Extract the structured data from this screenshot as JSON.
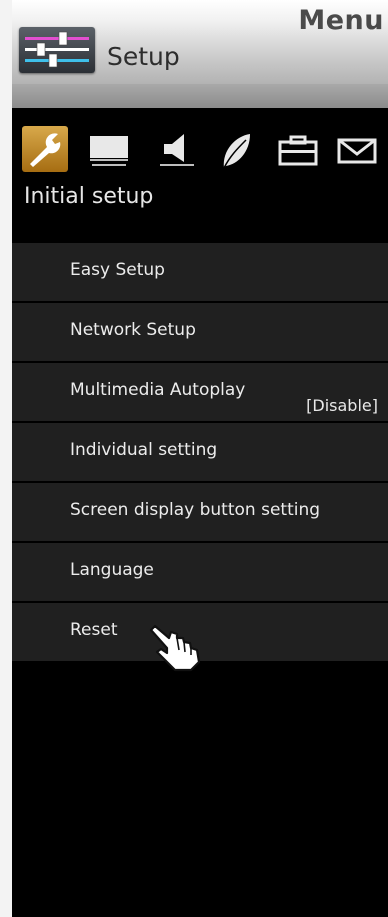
{
  "header": {
    "menu_title": "Menu",
    "section_title": "Setup",
    "section_icon": "sliders-icon"
  },
  "categories": [
    {
      "name": "wrench-icon",
      "selected": true
    },
    {
      "name": "monitor-icon",
      "selected": false
    },
    {
      "name": "speaker-icon",
      "selected": false
    },
    {
      "name": "leaf-icon",
      "selected": false
    },
    {
      "name": "toolbox-icon",
      "selected": false
    },
    {
      "name": "envelope-icon",
      "selected": false
    }
  ],
  "category_label": "Initial setup",
  "items": [
    {
      "label": "Easy Setup",
      "value": ""
    },
    {
      "label": "Network Setup",
      "value": ""
    },
    {
      "label": "Multimedia Autoplay",
      "value": "[Disable]"
    },
    {
      "label": "Individual setting",
      "value": ""
    },
    {
      "label": "Screen display button setting",
      "value": ""
    },
    {
      "label": "Language",
      "value": ""
    },
    {
      "label": "Reset",
      "value": ""
    }
  ],
  "cursor": "pointing-hand-cursor"
}
